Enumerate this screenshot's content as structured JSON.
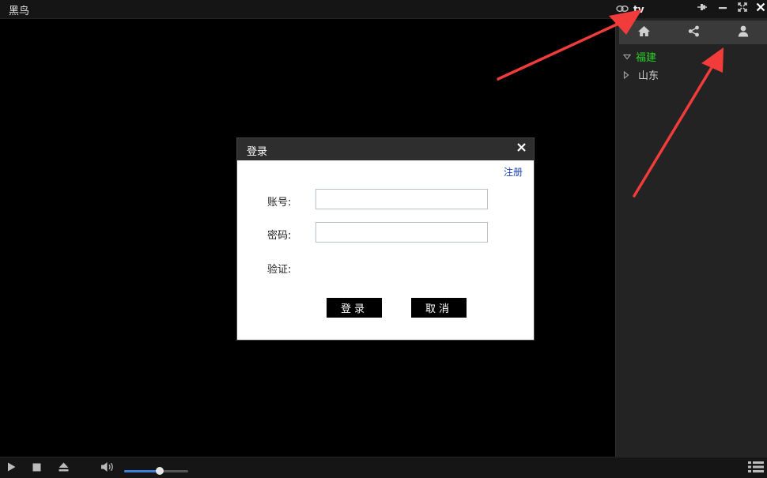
{
  "app": {
    "title": "黑鸟"
  },
  "topbar": {
    "tv_label": "tv"
  },
  "sidebar": {
    "tabs": [
      {
        "icon": "home-icon"
      },
      {
        "icon": "share-icon"
      },
      {
        "icon": "user-icon"
      }
    ],
    "tree": [
      {
        "label": "福建",
        "expanded": true
      },
      {
        "label": "山东",
        "expanded": false
      }
    ]
  },
  "dialog": {
    "title": "登录",
    "register_label": "注册",
    "account_label": "账号:",
    "account_value": "",
    "password_label": "密码:",
    "password_value": "",
    "verify_label": "验证:",
    "login_label": "登录",
    "cancel_label": "取消"
  },
  "controls": {
    "volume_level": 0.55
  },
  "colors": {
    "accent": "#3f7fdc",
    "tree_active": "#2bd12b",
    "arrow": "#f23b3b"
  }
}
